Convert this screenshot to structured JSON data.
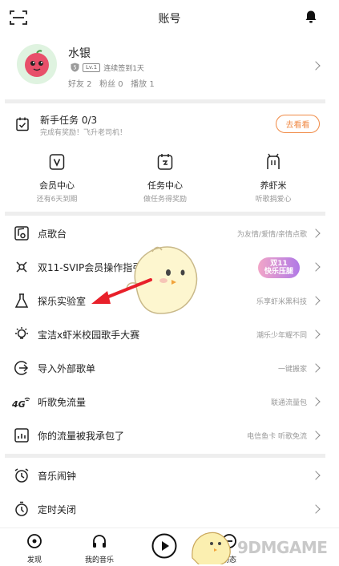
{
  "header": {
    "title": "账号"
  },
  "profile": {
    "name": "水银",
    "level_badge": "5",
    "level": "Lv.1",
    "checkin": "连续签到1天",
    "stats": "好友 2   粉丝 0   播放 1"
  },
  "task": {
    "title": "新手任务 0/3",
    "subtitle": "完成有奖励！飞升老司机！",
    "button": "去看看"
  },
  "quick": [
    {
      "label": "会员中心",
      "sub": "还有6天到期"
    },
    {
      "label": "任务中心",
      "sub": "做任务得奖励"
    },
    {
      "label": "养虾米",
      "sub": "听歌捐爱心"
    }
  ],
  "menu": [
    {
      "label": "点歌台",
      "hint": "为友情/爱情/亲情点歌"
    },
    {
      "label": "双11-SVIP会员操作指引",
      "hint": ""
    },
    {
      "label": "探乐实验室",
      "hint": "乐享虾米黑科技"
    },
    {
      "label": "宝洁x虾米校园歌手大赛",
      "hint": "潮乐少年耀不同"
    },
    {
      "label": "导入外部歌单",
      "hint": "一键搬家"
    },
    {
      "label": "听歌免流量",
      "hint": "联通流量包"
    },
    {
      "label": "你的流量被我承包了",
      "hint": "电信鱼卡 听歌免流"
    },
    {
      "label": "音乐闹钟",
      "hint": ""
    },
    {
      "label": "定时关闭",
      "hint": ""
    }
  ],
  "badge": {
    "line1": "双11",
    "line2": "快乐压腿"
  },
  "tabs": [
    {
      "label": "发现"
    },
    {
      "label": "我的音乐"
    },
    {
      "label": "动态"
    }
  ],
  "watermark": "9DMGAME",
  "colors": {
    "accent": "#f08a45",
    "divider": "#eeeeee",
    "arrow": "#e8202a"
  }
}
